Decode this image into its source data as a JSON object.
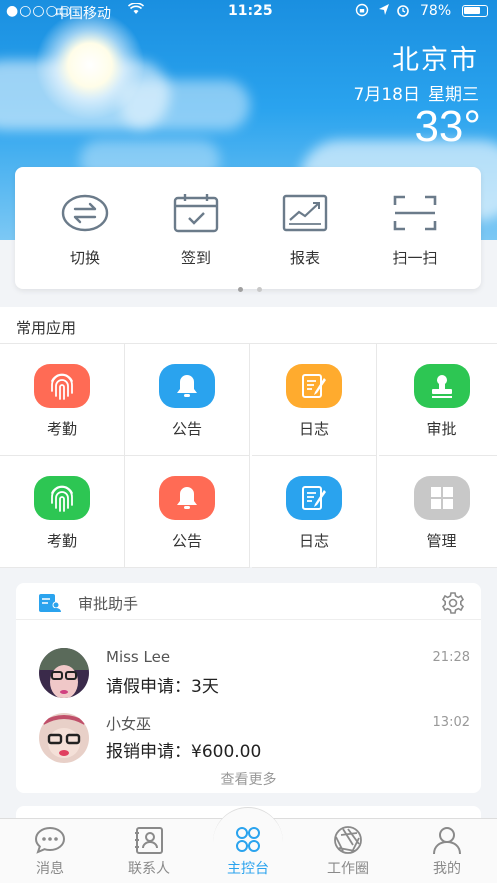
{
  "status_bar": {
    "signal": "●○○○○",
    "carrier": "中国移动",
    "wifi_icon": "wifi-icon",
    "time": "11:25",
    "battery": "78%",
    "battery_level": 0.78
  },
  "weather": {
    "city": "北京市",
    "date": "7月18日",
    "weekday": "星期三",
    "temperature": "33°"
  },
  "quick_actions": [
    {
      "label": "切换",
      "icon": "switch-icon"
    },
    {
      "label": "签到",
      "icon": "calendar-check-icon"
    },
    {
      "label": "报表",
      "icon": "report-chart-icon"
    },
    {
      "label": "扫一扫",
      "icon": "scan-icon"
    }
  ],
  "apps": {
    "title": "常用应用",
    "items": [
      {
        "label": "考勤",
        "icon": "fingerprint-icon",
        "color": "#ff6b55"
      },
      {
        "label": "公告",
        "icon": "bell-icon",
        "color": "#2aa3ee"
      },
      {
        "label": "日志",
        "icon": "notepad-icon",
        "color": "#ffab2e"
      },
      {
        "label": "审批",
        "icon": "stamp-icon",
        "color": "#2dc653"
      },
      {
        "label": "考勤",
        "icon": "fingerprint-icon",
        "color": "#2dc653"
      },
      {
        "label": "公告",
        "icon": "bell-icon",
        "color": "#ff6b55"
      },
      {
        "label": "日志",
        "icon": "notepad-icon",
        "color": "#2aa3ee"
      },
      {
        "label": "管理",
        "icon": "grid-icon",
        "color": "#c8c8c8"
      }
    ]
  },
  "assistant": {
    "title": "审批助手",
    "messages": [
      {
        "name": "Miss Lee",
        "body": "请假申请：3天",
        "time": "21:28"
      },
      {
        "name": "小女巫",
        "body": "报销申请：¥600.00",
        "time": "13:02"
      }
    ],
    "more_label": "查看更多"
  },
  "tabs": [
    {
      "label": "消息",
      "icon": "chat-bubble-icon"
    },
    {
      "label": "联系人",
      "icon": "contact-card-icon"
    },
    {
      "label": "主控台",
      "icon": "dashboard-icon",
      "active": true
    },
    {
      "label": "工作圈",
      "icon": "aperture-icon"
    },
    {
      "label": "我的",
      "icon": "user-icon"
    }
  ],
  "colors": {
    "accent": "#2aa3ee",
    "icon_gray": "#6b7b8a"
  }
}
